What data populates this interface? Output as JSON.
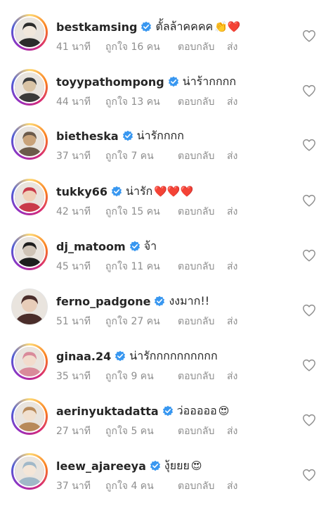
{
  "comments": [
    {
      "username": "bestkamsing",
      "verified": true,
      "text": "ตั้ลล้าคคคค",
      "emoji": "👏❤️",
      "time": "41 นาที",
      "likes": "ถูกใจ 16 คน",
      "reply": "ตอบกลับ",
      "send": "ส่ง"
    },
    {
      "username": "toyypathompong",
      "verified": true,
      "text": "น่าร้ากกกก",
      "emoji": "",
      "time": "44 นาที",
      "likes": "ถูกใจ 13 คน",
      "reply": "ตอบกลับ",
      "send": "ส่ง"
    },
    {
      "username": "bietheska",
      "verified": true,
      "text": "น่ารักกกก",
      "emoji": "",
      "time": "37 นาที",
      "likes": "ถูกใจ 7 คน",
      "reply": "ตอบกลับ",
      "send": "ส่ง"
    },
    {
      "username": "tukky66",
      "verified": true,
      "text": "น่ารัก",
      "emoji": "❤️❤️❤️",
      "time": "42 นาที",
      "likes": "ถูกใจ 15 คน",
      "reply": "ตอบกลับ",
      "send": "ส่ง"
    },
    {
      "username": "dj_matoom",
      "verified": true,
      "text": "จ้า",
      "emoji": "",
      "time": "45 นาที",
      "likes": "ถูกใจ 11 คน",
      "reply": "ตอบกลับ",
      "send": "ส่ง"
    },
    {
      "username": "ferno_padgone",
      "verified": true,
      "text": "งงมาก!!",
      "emoji": "",
      "time": "51 นาที",
      "likes": "ถูกใจ 27 คน",
      "reply": "ตอบกลับ",
      "send": "ส่ง"
    },
    {
      "username": "ginaa.24",
      "verified": true,
      "text": "น่ารักกกกกกกกกก",
      "emoji": "",
      "time": "35 นาที",
      "likes": "ถูกใจ 9 คน",
      "reply": "ตอบกลับ",
      "send": "ส่ง"
    },
    {
      "username": "aerinyuktadatta",
      "verified": true,
      "text": "ว่อออออ",
      "emoji": "😍",
      "time": "27 นาที",
      "likes": "ถูกใจ 5 คน",
      "reply": "ตอบกลับ",
      "send": "ส่ง"
    },
    {
      "username": "leew_ajareeya",
      "verified": true,
      "text": "งุ้ยยย",
      "emoji": "😍",
      "time": "37 นาที",
      "likes": "ถูกใจ 4 คน",
      "reply": "ตอบกลับ",
      "send": "ส่ง"
    }
  ],
  "colors": {
    "username": "#262626",
    "meta": "#8e8e8e",
    "verified": "#3897f0",
    "heart_icon": "#8e8e8e"
  }
}
